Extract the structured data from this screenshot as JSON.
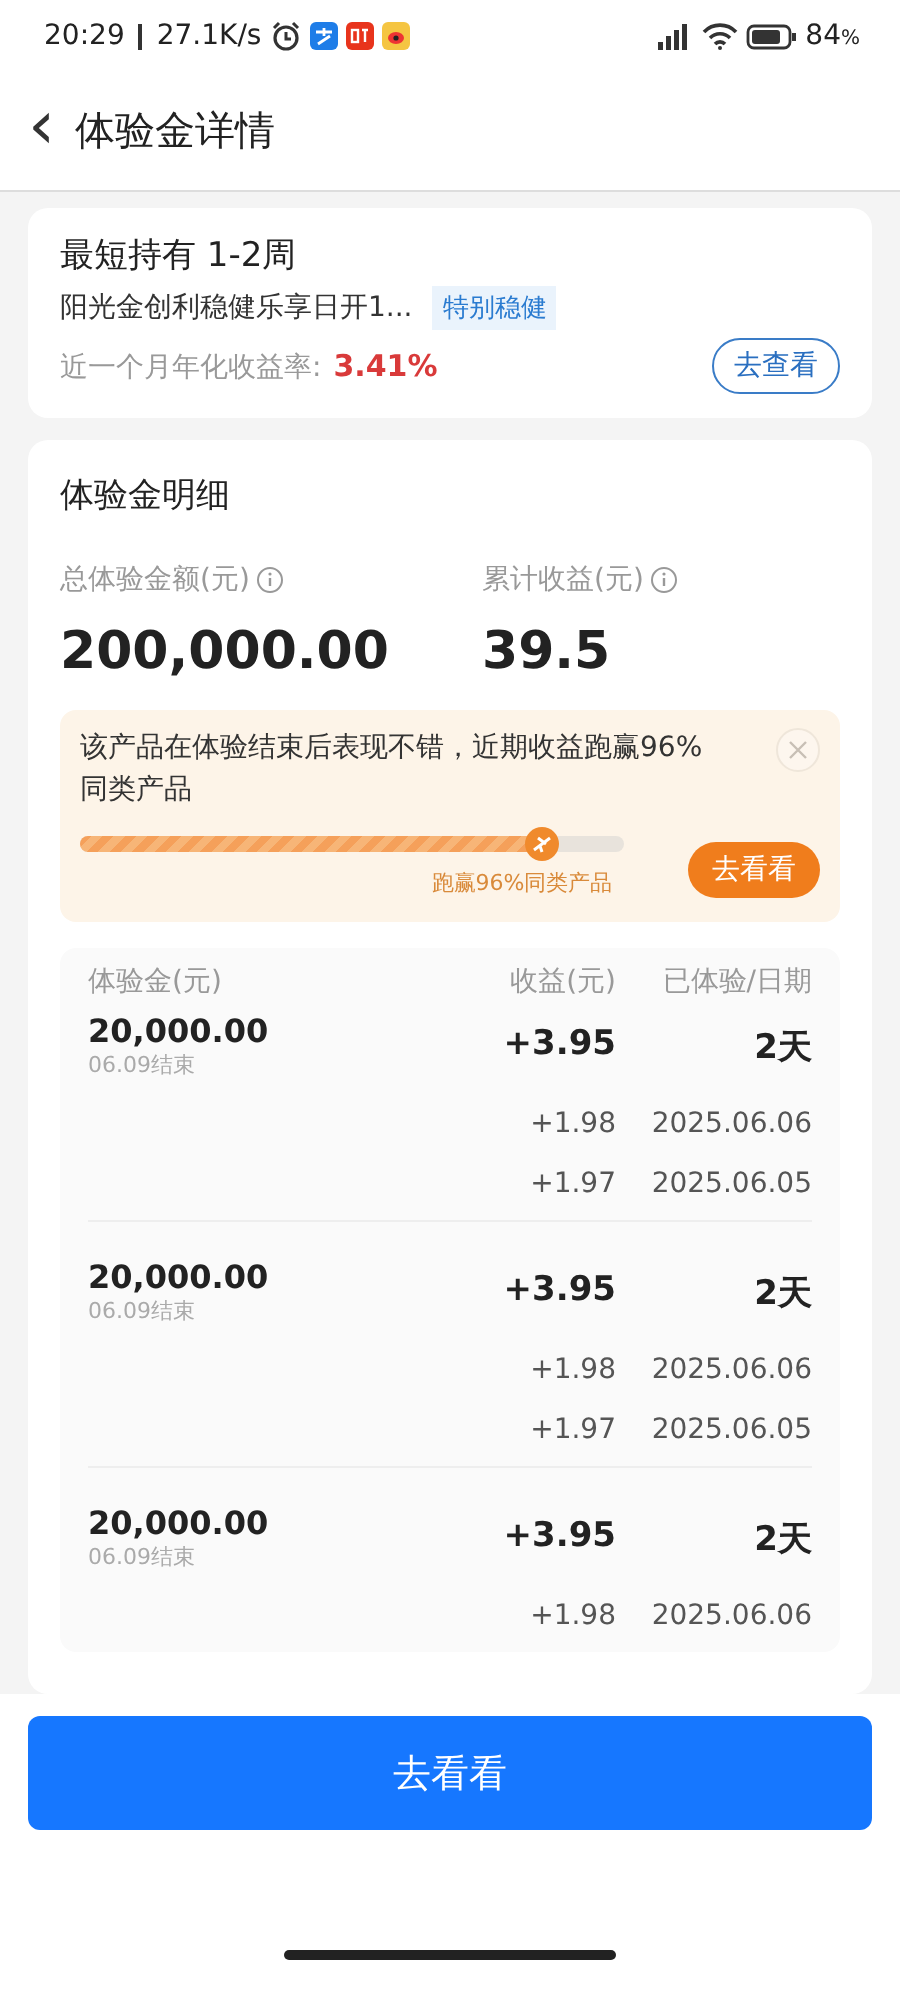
{
  "status_bar": {
    "time": "20:29",
    "speed": "27.1K/s",
    "battery": "84",
    "battery_unit": "%"
  },
  "header": {
    "back": "‹",
    "title": "体验金详情"
  },
  "product_card": {
    "hold": "最短持有 1-2周",
    "name": "阳光金创利稳健乐享日开1...",
    "tag": "特别稳健",
    "rate_label": "近一个月年化收益率:",
    "rate": "3.41%",
    "button": "去查看"
  },
  "detail_card": {
    "title": "体验金明细",
    "stats": [
      {
        "label": "总体验金额(元)",
        "value": "200,000.00"
      },
      {
        "label": "累计收益(元)",
        "value": "39.5"
      }
    ],
    "banner": {
      "text": "该产品在体验结束后表现不错，近期收益跑赢96%同类产品",
      "level": 0.85,
      "caption": "跑赢96%同类产品",
      "button": "去看看"
    },
    "table": {
      "columns": [
        "体验金(元)",
        "收益(元)",
        "已体验/日期"
      ],
      "groups": [
        {
          "amount": "20,000.00",
          "end": "06.09结束",
          "income": "+3.95",
          "days": "2天",
          "details": [
            {
              "income": "+1.98",
              "date": "2025.06.06"
            },
            {
              "income": "+1.97",
              "date": "2025.06.05"
            }
          ]
        },
        {
          "amount": "20,000.00",
          "end": "06.09结束",
          "income": "+3.95",
          "days": "2天",
          "details": [
            {
              "income": "+1.98",
              "date": "2025.06.06"
            },
            {
              "income": "+1.97",
              "date": "2025.06.05"
            }
          ]
        },
        {
          "amount": "20,000.00",
          "end": "06.09结束",
          "income": "+3.95",
          "days": "2天",
          "details": [
            {
              "income": "+1.98",
              "date": "2025.06.06"
            }
          ]
        }
      ]
    }
  },
  "bottom_button": "去看看"
}
